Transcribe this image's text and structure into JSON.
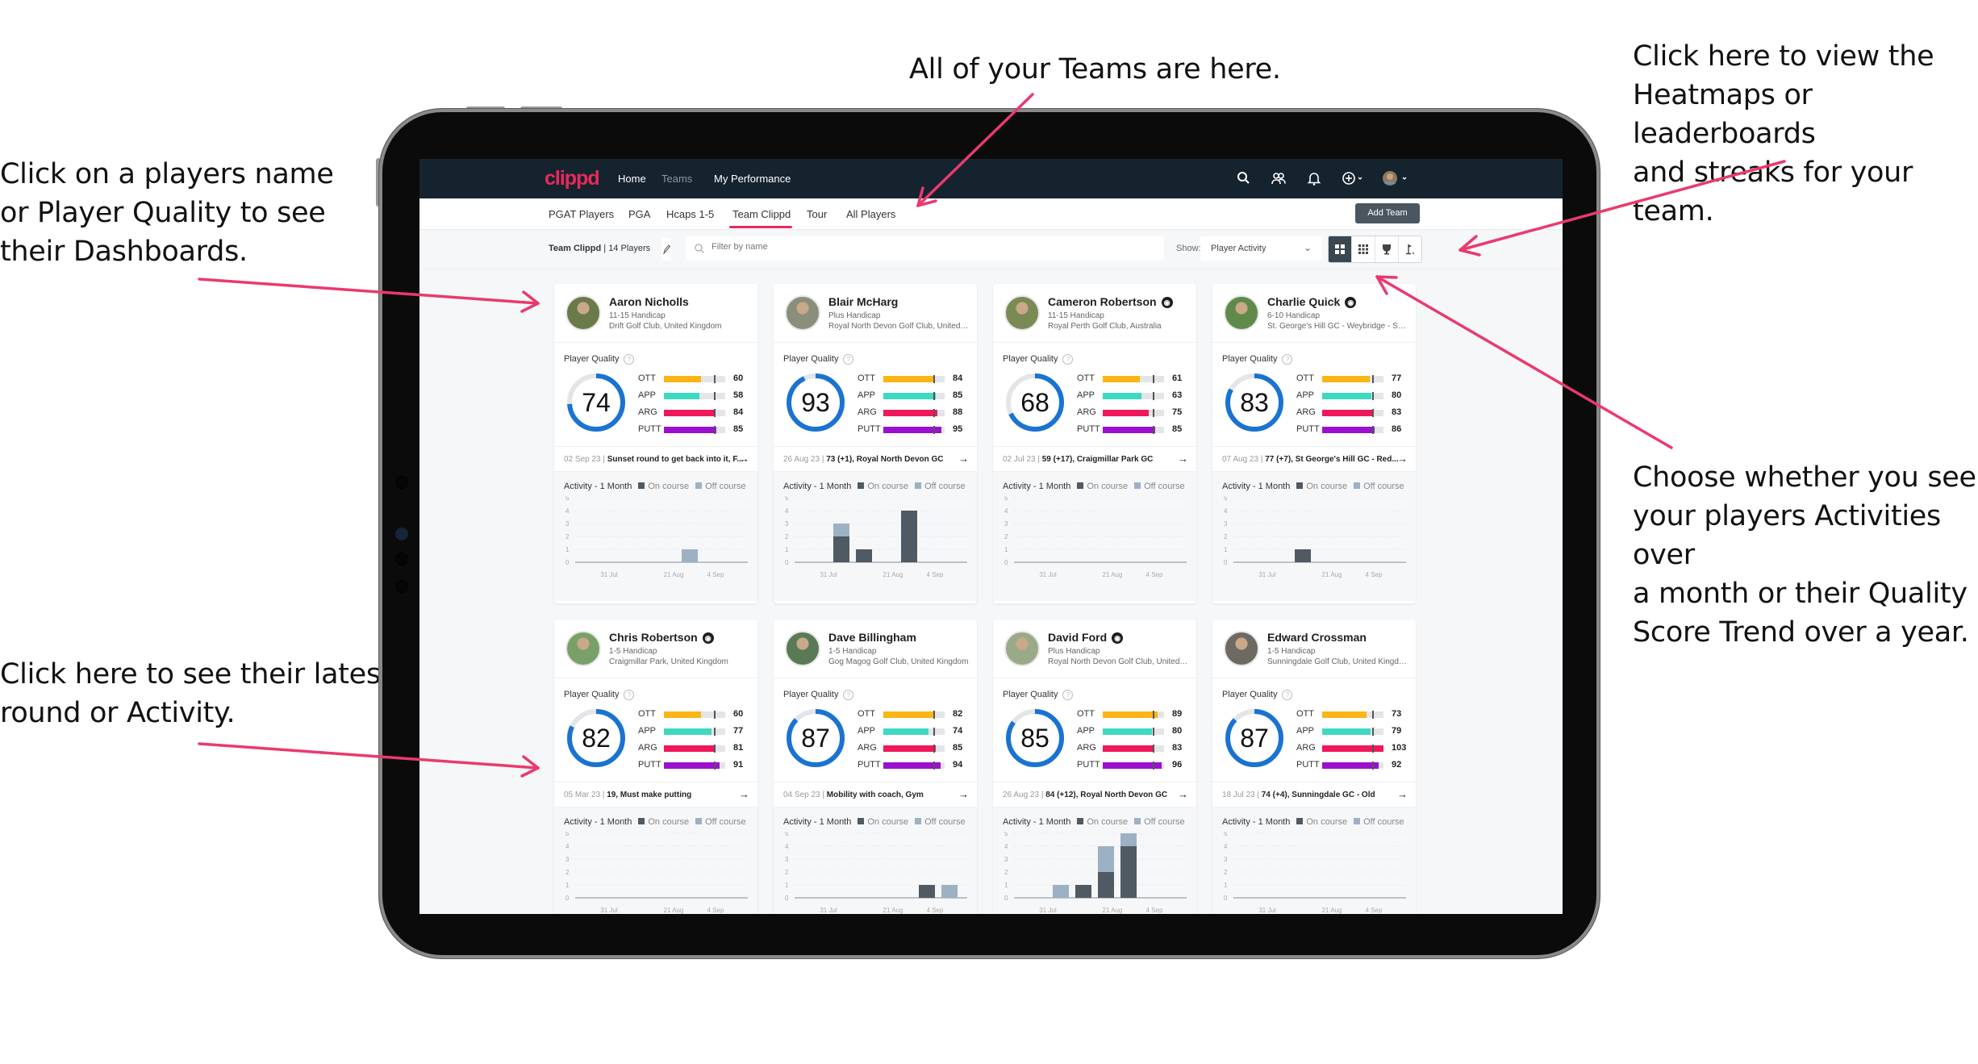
{
  "annotations": {
    "top_center": "All of your Teams are here.",
    "top_right": "Click here to view the\nHeatmaps or leaderboards\nand streaks for your team.",
    "left_top": "Click on a players name\nor Player Quality to see\ntheir Dashboards.",
    "left_bottom": "Click here to see their latest\nround or Activity.",
    "right_mid": "Choose whether you see\nyour players Activities over\na month or their Quality\nScore Trend over a year."
  },
  "colors": {
    "accent": "#e8295c",
    "nav_bg": "#15232e",
    "ring": "#1a73d1",
    "ott": "#fbb614",
    "app": "#3dd9c1",
    "arg": "#f0185a",
    "putt": "#9b0fcf",
    "on_course": "#4f5a63",
    "off_course": "#9db1c4"
  },
  "nav": {
    "logo": "clippd",
    "links": [
      "Home",
      "Teams",
      "My Performance"
    ],
    "icons": [
      "search-icon",
      "users-icon",
      "bell-icon",
      "plus-circle-icon",
      "user-avatar"
    ]
  },
  "subtabs": {
    "items": [
      "PGAT Players",
      "PGA",
      "Hcaps 1-5",
      "Team Clippd",
      "Tour",
      "All Players"
    ],
    "active": "Team Clippd",
    "add_team": "Add Team"
  },
  "filterbar": {
    "team_name": "Team Clippd",
    "player_count": "14 Players",
    "search_placeholder": "Filter by name",
    "show_label": "Show:",
    "show_value": "Player Activity",
    "views": [
      "grid-large-icon",
      "grid-small-icon",
      "trophy-icon",
      "flag-icon"
    ]
  },
  "card_labels": {
    "player_quality": "Player Quality",
    "sg_names": [
      "OTT",
      "APP",
      "ARG",
      "PUTT"
    ],
    "activity_title": "Activity - 1 Month",
    "on_course": "On course",
    "off_course": "Off course",
    "x_ticks": [
      "31 Jul",
      "21 Aug",
      "4 Sep"
    ],
    "y_ticks": [
      "0",
      "1",
      "2",
      "3",
      "4",
      "5"
    ]
  },
  "players": [
    {
      "name": "Aaron Nicholls",
      "pro": false,
      "handicap": "11-15 Handicap",
      "club": "Drift Golf Club, United Kingdom",
      "quality": 74,
      "sg": [
        60,
        58,
        84,
        85
      ],
      "latest_date": "02 Sep 23",
      "latest_text": "Sunset round to get back into it, F...",
      "activity": {
        "on": [
          0,
          0,
          0,
          0,
          0,
          0
        ],
        "off": [
          0,
          0,
          0,
          0,
          1,
          0
        ]
      }
    },
    {
      "name": "Blair McHarg",
      "pro": false,
      "handicap": "Plus Handicap",
      "club": "Royal North Devon Golf Club, United Kin...",
      "quality": 93,
      "sg": [
        84,
        85,
        88,
        95
      ],
      "latest_date": "26 Aug 23",
      "latest_text": "73 (+1), Royal North Devon GC",
      "activity": {
        "on": [
          0,
          2,
          1,
          0,
          4,
          0
        ],
        "off": [
          0,
          1,
          0,
          0,
          0,
          0
        ]
      }
    },
    {
      "name": "Cameron Robertson",
      "pro": true,
      "handicap": "11-15 Handicap",
      "club": "Royal Perth Golf Club, Australia",
      "quality": 68,
      "sg": [
        61,
        63,
        75,
        85
      ],
      "latest_date": "02 Jul 23",
      "latest_text": "59 (+17), Craigmillar Park GC",
      "activity": {
        "on": [
          0,
          0,
          0,
          0,
          0,
          0
        ],
        "off": [
          0,
          0,
          0,
          0,
          0,
          0
        ]
      }
    },
    {
      "name": "Charlie Quick",
      "pro": true,
      "handicap": "6-10 Handicap",
      "club": "St. George's Hill GC - Weybridge - Surrey, ...",
      "quality": 83,
      "sg": [
        77,
        80,
        83,
        86
      ],
      "latest_date": "07 Aug 23",
      "latest_text": "77 (+7), St George's Hill GC - Red...",
      "activity": {
        "on": [
          0,
          0,
          1,
          0,
          0,
          0
        ],
        "off": [
          0,
          0,
          0,
          0,
          0,
          0
        ]
      }
    },
    {
      "name": "Chris Robertson",
      "pro": true,
      "handicap": "1-5 Handicap",
      "club": "Craigmillar Park, United Kingdom",
      "quality": 82,
      "sg": [
        60,
        77,
        81,
        91
      ],
      "latest_date": "05 Mar 23",
      "latest_text": "19, Must make putting",
      "activity": {
        "on": [
          0,
          0,
          0,
          0,
          0,
          0
        ],
        "off": [
          0,
          0,
          0,
          0,
          0,
          0
        ]
      }
    },
    {
      "name": "Dave Billingham",
      "pro": false,
      "handicap": "1-5 Handicap",
      "club": "Gog Magog Golf Club, United Kingdom",
      "quality": 87,
      "sg": [
        82,
        74,
        85,
        94
      ],
      "latest_date": "04 Sep 23",
      "latest_text": "Mobility with coach, Gym",
      "activity": {
        "on": [
          0,
          0,
          0,
          0,
          0,
          1,
          0
        ],
        "off": [
          0,
          0,
          0,
          0,
          0,
          0,
          1
        ]
      }
    },
    {
      "name": "David Ford",
      "pro": true,
      "handicap": "Plus Handicap",
      "club": "Royal North Devon Golf Club, United Kin...",
      "quality": 85,
      "sg": [
        89,
        80,
        83,
        96
      ],
      "latest_date": "26 Aug 23",
      "latest_text": "84 (+12), Royal North Devon GC",
      "activity": {
        "on": [
          0,
          0,
          1,
          2,
          4,
          0
        ],
        "off": [
          0,
          1,
          0,
          2,
          1,
          0
        ]
      }
    },
    {
      "name": "Edward Crossman",
      "pro": false,
      "handicap": "1-5 Handicap",
      "club": "Sunningdale Golf Club, United Kingdom",
      "quality": 87,
      "sg": [
        73,
        79,
        103,
        92
      ],
      "latest_date": "18 Jul 23",
      "latest_text": "74 (+4), Sunningdale GC - Old",
      "activity": {
        "on": [
          0,
          0,
          0,
          0,
          0,
          0
        ],
        "off": [
          0,
          0,
          0,
          0,
          0,
          0
        ]
      }
    }
  ]
}
